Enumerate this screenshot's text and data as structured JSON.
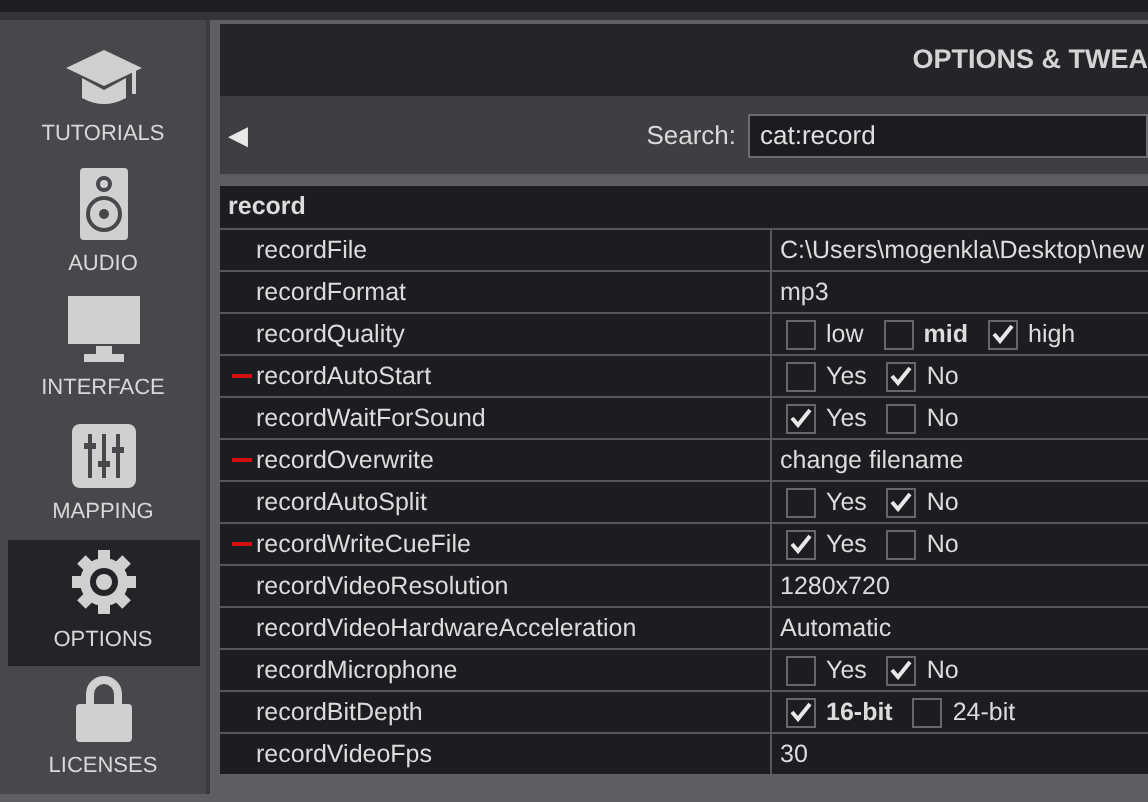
{
  "sidebar": {
    "items": [
      {
        "label": "TUTORIALS",
        "selected": false
      },
      {
        "label": "AUDIO",
        "selected": false
      },
      {
        "label": "INTERFACE",
        "selected": false
      },
      {
        "label": "MAPPING",
        "selected": false
      },
      {
        "label": "OPTIONS",
        "selected": true
      },
      {
        "label": "LICENSES",
        "selected": false
      }
    ]
  },
  "panel": {
    "title": "OPTIONS & TWEA",
    "back": "◀",
    "search": {
      "label": "Search:",
      "value": "cat:record"
    }
  },
  "table": {
    "group": "record",
    "rows": [
      {
        "name": "recordFile",
        "modified": false,
        "kind": "text",
        "value": "C:\\Users\\mogenkla\\Desktop\\new"
      },
      {
        "name": "recordFormat",
        "modified": false,
        "kind": "text",
        "value": "mp3"
      },
      {
        "name": "recordQuality",
        "modified": false,
        "kind": "choice",
        "options": [
          {
            "label": "low",
            "checked": false,
            "bold": false
          },
          {
            "label": "mid",
            "checked": false,
            "bold": true
          },
          {
            "label": "high",
            "checked": true,
            "bold": false
          }
        ]
      },
      {
        "name": "recordAutoStart",
        "modified": true,
        "kind": "choice",
        "options": [
          {
            "label": "Yes",
            "checked": false,
            "bold": false
          },
          {
            "label": "No",
            "checked": true,
            "bold": false
          }
        ]
      },
      {
        "name": "recordWaitForSound",
        "modified": false,
        "kind": "choice",
        "options": [
          {
            "label": "Yes",
            "checked": true,
            "bold": false
          },
          {
            "label": "No",
            "checked": false,
            "bold": false
          }
        ]
      },
      {
        "name": "recordOverwrite",
        "modified": true,
        "kind": "text",
        "value": "change filename"
      },
      {
        "name": "recordAutoSplit",
        "modified": false,
        "kind": "choice",
        "options": [
          {
            "label": "Yes",
            "checked": false,
            "bold": false
          },
          {
            "label": "No",
            "checked": true,
            "bold": false
          }
        ]
      },
      {
        "name": "recordWriteCueFile",
        "modified": true,
        "kind": "choice",
        "options": [
          {
            "label": "Yes",
            "checked": true,
            "bold": false
          },
          {
            "label": "No",
            "checked": false,
            "bold": false
          }
        ]
      },
      {
        "name": "recordVideoResolution",
        "modified": false,
        "kind": "text",
        "value": "1280x720"
      },
      {
        "name": "recordVideoHardwareAcceleration",
        "modified": false,
        "kind": "text",
        "value": "Automatic"
      },
      {
        "name": "recordMicrophone",
        "modified": false,
        "kind": "choice",
        "options": [
          {
            "label": "Yes",
            "checked": false,
            "bold": false
          },
          {
            "label": "No",
            "checked": true,
            "bold": false
          }
        ]
      },
      {
        "name": "recordBitDepth",
        "modified": false,
        "kind": "choice",
        "options": [
          {
            "label": "16-bit",
            "checked": true,
            "bold": true
          },
          {
            "label": "24-bit",
            "checked": false,
            "bold": false
          }
        ]
      },
      {
        "name": "recordVideoFps",
        "modified": false,
        "kind": "text",
        "value": "30"
      }
    ]
  }
}
